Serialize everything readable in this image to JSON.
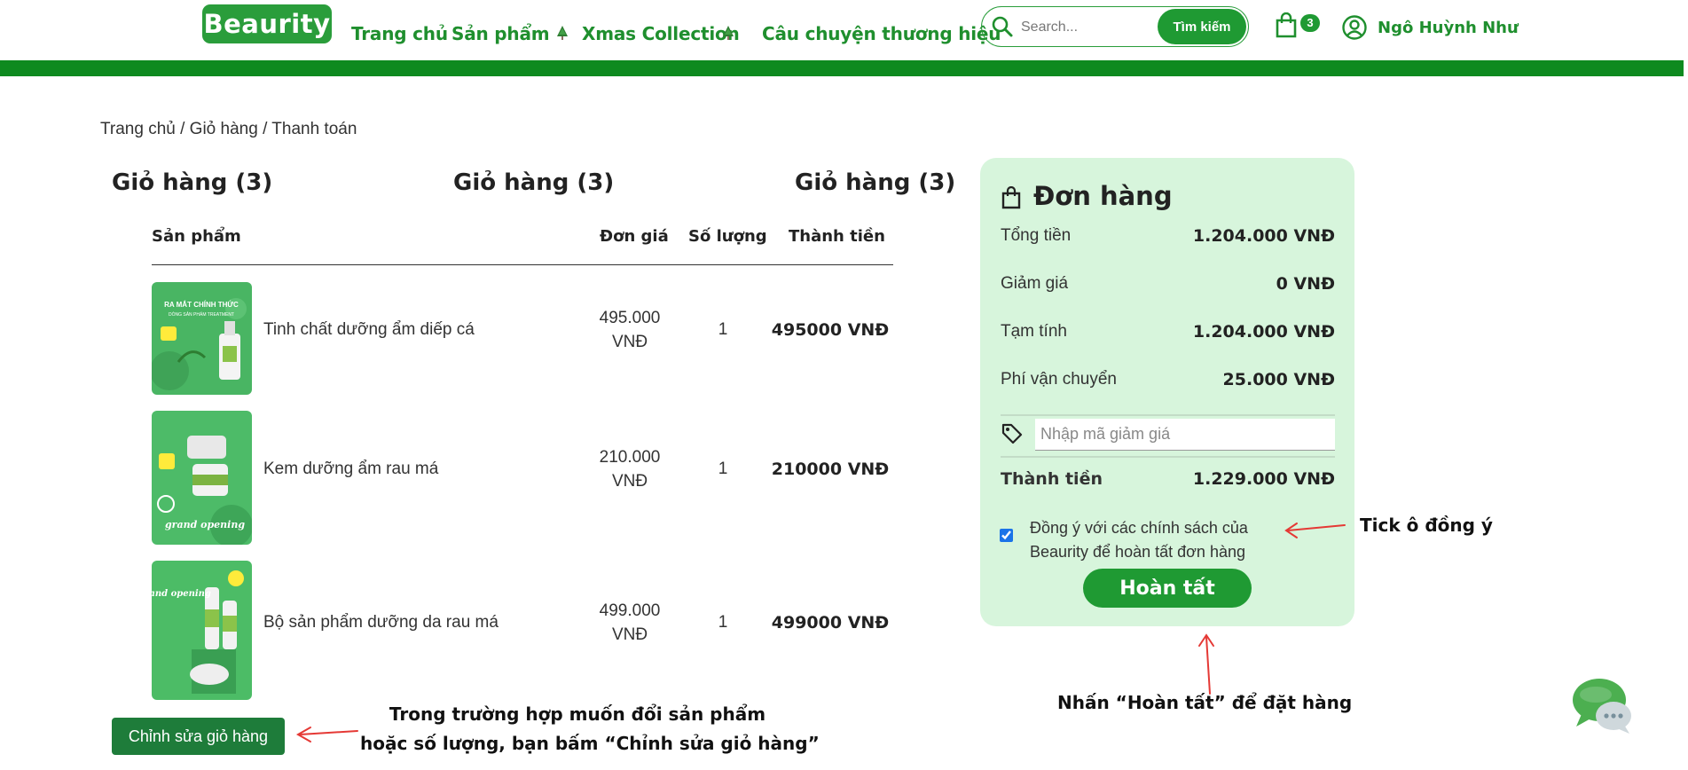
{
  "header": {
    "logo": "Beaurity",
    "nav": [
      "Trang chủ",
      "Sản phẩm",
      "Xmas Collection",
      "Câu chuyện thương hiệu"
    ],
    "search_placeholder": "Search...",
    "search_button": "Tìm kiếm",
    "cart_count": "3",
    "user_name": "Ngô Huỳnh Như"
  },
  "breadcrumb": "Trang chủ / Giỏ hàng / Thanh toán",
  "cart_titles": [
    "Giỏ hàng (3)",
    "Giỏ hàng (3)",
    "Giỏ hàng (3)"
  ],
  "table": {
    "headers": [
      "Sản phẩm",
      "Đơn giá",
      "Số lượng",
      "Thành tiền"
    ],
    "rows": [
      {
        "name": "Tinh chất dưỡng ẩm diếp cá",
        "price_line1": "495.000",
        "price_line2": "VNĐ",
        "qty": "1",
        "total": "495000 VNĐ",
        "image_caption": "RA MẮT CHÍNH THỨC",
        "image_sub": "DÒNG SẢN PHẨM TREATMENT"
      },
      {
        "name": "Kem dưỡng ẩm rau má",
        "price_line1": "210.000",
        "price_line2": "VNĐ",
        "qty": "1",
        "total": "210000 VNĐ",
        "image_caption": "grand opening",
        "image_sub": ""
      },
      {
        "name": "Bộ sản phẩm dưỡng da rau má",
        "price_line1": "499.000",
        "price_line2": "VNĐ",
        "qty": "1",
        "total": "499000 VNĐ",
        "image_caption": "grand opening",
        "image_sub": ""
      }
    ]
  },
  "edit_cart_button": "Chỉnh sửa giỏ hàng",
  "order": {
    "title": "Đơn hàng",
    "rows": [
      {
        "label": "Tổng tiền",
        "value": "1.204.000 VNĐ"
      },
      {
        "label": "Giảm giá",
        "value": "0 VNĐ"
      },
      {
        "label": "Tạm tính",
        "value": "1.204.000 VNĐ"
      },
      {
        "label": "Phí vận chuyển",
        "value": "25.000 VNĐ"
      }
    ],
    "discount_placeholder": "Nhập mã giảm giá",
    "final_label": "Thành tiền",
    "final_value": "1.229.000 VNĐ",
    "agree_text": "Đồng ý với các chính sách của Beaurity để hoàn tất đơn hàng",
    "agree_checked": true,
    "finish_button": "Hoàn tất"
  },
  "annotations": {
    "tick": "Tick ô đồng ý",
    "finish": "Nhấn “Hoàn tất” để đặt hàng",
    "edit_line1": "Trong trường hợp muốn đổi sản phẩm",
    "edit_line2": "hoặc số lượng, bạn bấm “Chỉnh sửa giỏ hàng”"
  },
  "colors": {
    "brand_green": "#1f9a33",
    "header_bar": "#0e8a1f",
    "panel_bg": "#d7f5dc",
    "annotation_arrow": "#e53935"
  }
}
